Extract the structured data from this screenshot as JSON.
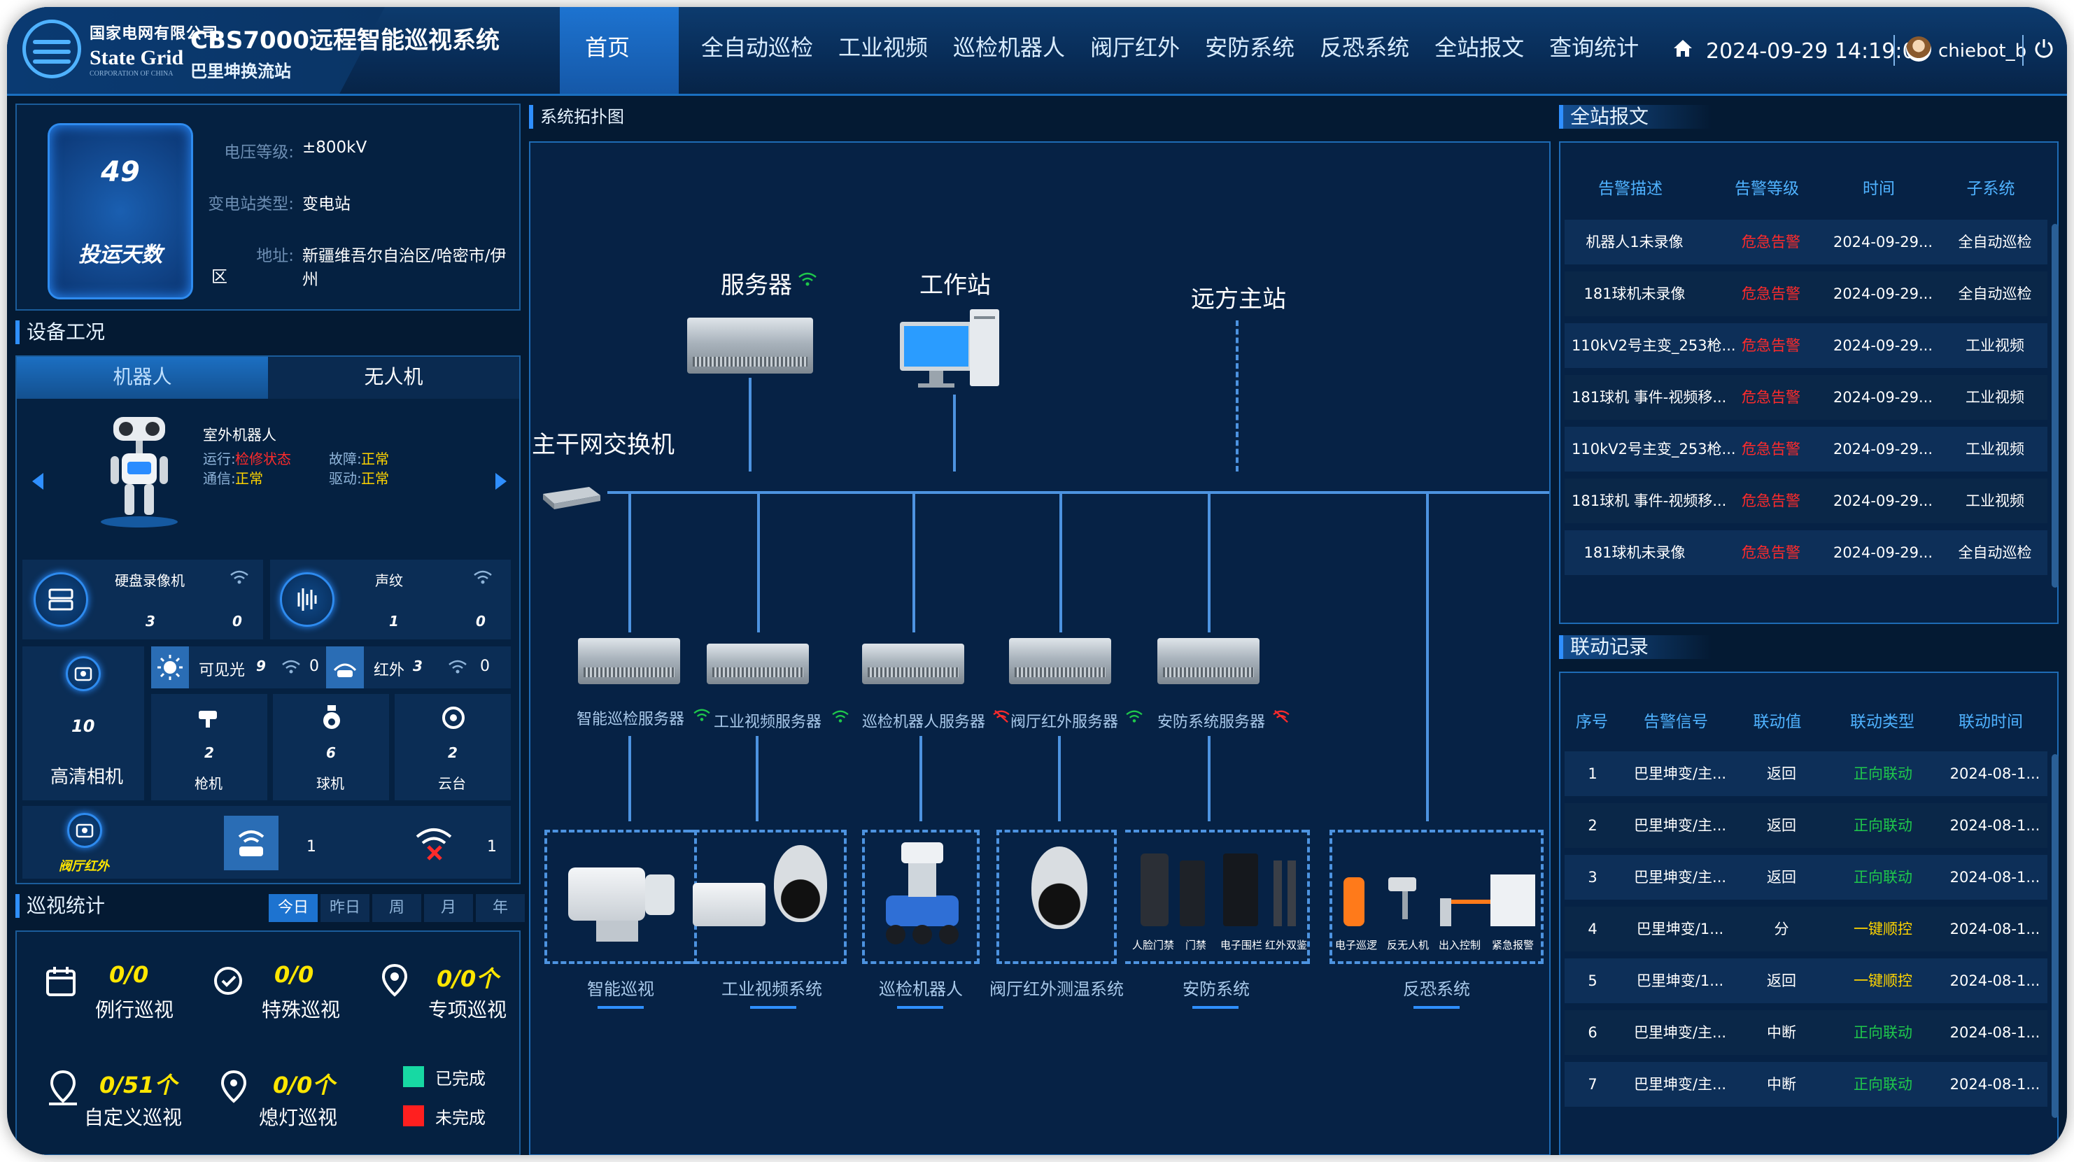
{
  "header": {
    "company": "国家电网有限公司",
    "brand": "State Grid",
    "corp": "CORPORATION OF CHINA",
    "system_title": "CBS7000远程智能巡视系统",
    "station": "巴里坤换流站",
    "nav": [
      "首页",
      "全自动巡检",
      "工业视频",
      "巡检机器人",
      "阀厅红外",
      "安防系统",
      "反恐系统",
      "全站报文",
      "查询统计"
    ],
    "datetime": "2024-09-29 14:19:08",
    "user": "chiebot_b"
  },
  "station_info": {
    "days": "49",
    "days_label": "投运天数",
    "fields": [
      {
        "k": "电压等级:",
        "v": "±800kV"
      },
      {
        "k": "变电站类型:",
        "v": "变电站"
      },
      {
        "k": "地址:",
        "v": "新疆维吾尔自治区/哈密市/伊州"
      }
    ],
    "address_cont": "区"
  },
  "device": {
    "title": "设备工况",
    "tabs": [
      "机器人",
      "无人机"
    ],
    "robot": {
      "name": "室外机器人",
      "run_k": "运行:",
      "run_v": "检修状态",
      "fault_k": "故障:",
      "fault_v": "正常",
      "comm_k": "通信:",
      "comm_v": "正常",
      "drive_k": "驱动:",
      "drive_v": "正常"
    },
    "nvr": {
      "label": "硬盘录像机",
      "a": "3",
      "b": "0"
    },
    "sound": {
      "label": "声纹",
      "a": "1",
      "b": "0"
    },
    "visible": {
      "label": "可见光",
      "a": "9",
      "b": "0"
    },
    "infrared": {
      "label": "红外",
      "a": "3",
      "b": "0"
    },
    "hd_camera": {
      "label": "高清相机",
      "num": "10"
    },
    "gun": {
      "label": "枪机",
      "num": "2"
    },
    "ball": {
      "label": "球机",
      "num": "6"
    },
    "ptz": {
      "label": "云台",
      "num": "2"
    },
    "valve_ir": {
      "label": "阀厅红外",
      "a": "1",
      "b": "1"
    }
  },
  "patrol": {
    "title": "巡视统计",
    "tabs": [
      "今日",
      "昨日",
      "周",
      "月",
      "年"
    ],
    "items": [
      {
        "val": "0/0",
        "label": "例行巡视"
      },
      {
        "val": "0/0",
        "label": "特殊巡视"
      },
      {
        "val": "0/0个",
        "label": "专项巡视"
      },
      {
        "val": "0/51个",
        "label": "自定义巡视"
      },
      {
        "val": "0/0个",
        "label": "熄灯巡视"
      }
    ],
    "legend": [
      {
        "label": "已完成",
        "color": "#17d9a3"
      },
      {
        "label": "未完成",
        "color": "#ff1f1f"
      }
    ]
  },
  "topology": {
    "title": "系统拓扑图",
    "server": "服务器",
    "workstation": "工作站",
    "remote": "远方主站",
    "switch": "主干网交换机",
    "servers": [
      "智能巡检服务器",
      "工业视频服务器",
      "巡检机器人服务器",
      "阀厅红外服务器",
      "安防系统服务器"
    ],
    "systems": [
      "智能巡视",
      "工业视频系统",
      "巡检机器人",
      "阀厅红外测温系统",
      "安防系统",
      "反恐系统"
    ],
    "security_items": [
      "人脸门禁",
      "门禁",
      "电子围栏",
      "红外双鉴"
    ],
    "antiterror_items": [
      "电子巡逻",
      "反无人机",
      "出入控制",
      "紧急报警"
    ]
  },
  "messages": {
    "title": "全站报文",
    "headers": [
      "告警描述",
      "告警等级",
      "时间",
      "子系统"
    ],
    "rows": [
      [
        "机器人1未录像",
        "危急告警",
        "2024-09-29...",
        "全自动巡检"
      ],
      [
        "181球机未录像",
        "危急告警",
        "2024-09-29...",
        "全自动巡检"
      ],
      [
        "110kV2号主变_253枪...",
        "危急告警",
        "2024-09-29...",
        "工业视频"
      ],
      [
        "181球机 事件-视频移...",
        "危急告警",
        "2024-09-29...",
        "工业视频"
      ],
      [
        "110kV2号主变_253枪...",
        "危急告警",
        "2024-09-29...",
        "工业视频"
      ],
      [
        "181球机 事件-视频移...",
        "危急告警",
        "2024-09-29...",
        "工业视频"
      ],
      [
        "181球机未录像",
        "危急告警",
        "2024-09-29...",
        "全自动巡检"
      ]
    ]
  },
  "linkage": {
    "title": "联动记录",
    "headers": [
      "序号",
      "告警信号",
      "联动值",
      "联动类型",
      "联动时间"
    ],
    "rows": [
      [
        "1",
        "巴里坤变/主...",
        "返回",
        "正向联动",
        "2024-08-1..."
      ],
      [
        "2",
        "巴里坤变/主...",
        "返回",
        "正向联动",
        "2024-08-1..."
      ],
      [
        "3",
        "巴里坤变/主...",
        "返回",
        "正向联动",
        "2024-08-1..."
      ],
      [
        "4",
        "巴里坤变/1...",
        "分",
        "一键顺控",
        "2024-08-1..."
      ],
      [
        "5",
        "巴里坤变/1...",
        "返回",
        "一键顺控",
        "2024-08-1..."
      ],
      [
        "6",
        "巴里坤变/主...",
        "中断",
        "正向联动",
        "2024-08-1..."
      ],
      [
        "7",
        "巴里坤变/主...",
        "中断",
        "正向联动",
        "2024-08-1..."
      ]
    ]
  },
  "colors": {
    "danger": "#ff2b2b",
    "positive": "#1fc84b",
    "oneclick": "#ffd400",
    "accent": "#2f8fff"
  }
}
